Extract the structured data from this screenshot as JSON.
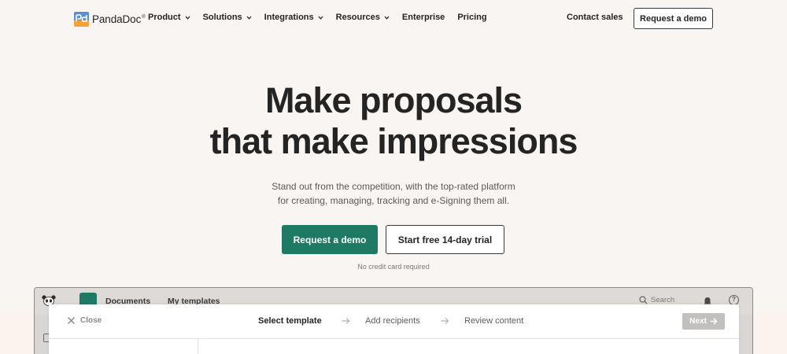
{
  "brand": {
    "name": "PandaDoc",
    "trademark": "®"
  },
  "nav": {
    "items": [
      {
        "label": "Product",
        "dropdown": true
      },
      {
        "label": "Solutions",
        "dropdown": true
      },
      {
        "label": "Integrations",
        "dropdown": true
      },
      {
        "label": "Resources",
        "dropdown": true
      },
      {
        "label": "Enterprise",
        "dropdown": false
      },
      {
        "label": "Pricing",
        "dropdown": false
      }
    ],
    "contact_label": "Contact sales",
    "demo_label": "Request a demo"
  },
  "hero": {
    "title_line1": "Make proposals",
    "title_line2": "that make impressions",
    "subtitle_line1": "Stand out from the competition, with the top-rated platform",
    "subtitle_line2": "for creating, managing, tracking and e-Signing them all.",
    "primary_cta": "Request a demo",
    "secondary_cta": "Start free 14-day trial",
    "note": "No credit card required"
  },
  "app_preview": {
    "tabs": [
      "Documents",
      "My templates"
    ],
    "search_placeholder": "Search",
    "help_symbol": "?",
    "modal": {
      "close_label": "Close",
      "steps": [
        "Select template",
        "Add recipients",
        "Review content"
      ],
      "active_step": "Select template",
      "next_label": "Next"
    }
  },
  "colors": {
    "background": "#f8f5f3",
    "primary_green": "#1f7a63",
    "text_dark": "#242424",
    "disabled_gray": "#c2c0bf"
  }
}
